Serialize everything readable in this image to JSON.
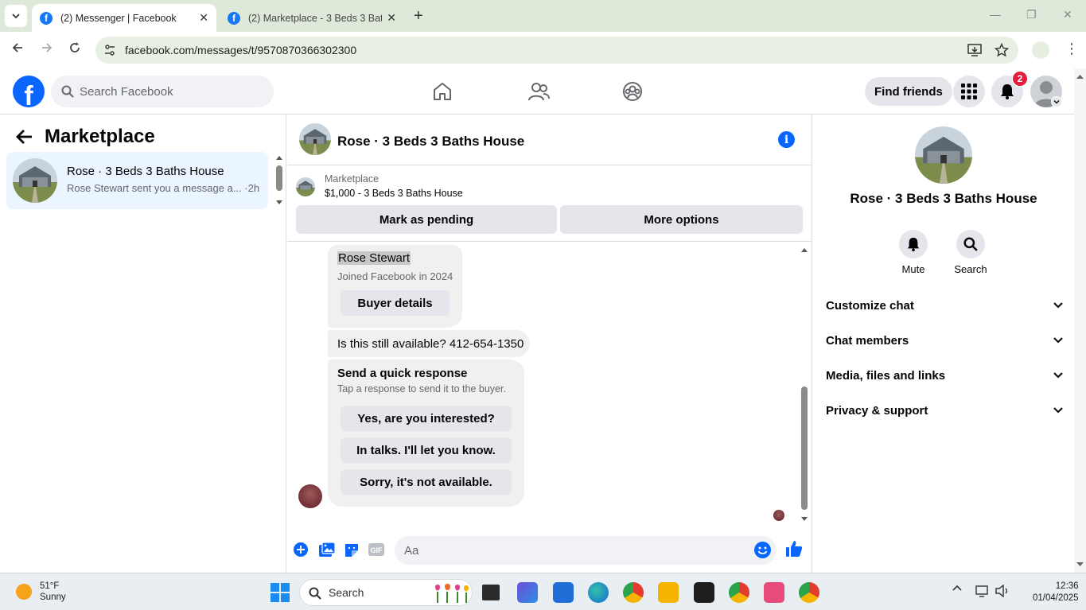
{
  "browser": {
    "tabs": [
      {
        "title": "(2) Messenger | Facebook",
        "active": true
      },
      {
        "title": "(2) Marketplace - 3 Beds 3 Bath",
        "active": false
      }
    ],
    "url": "facebook.com/messages/t/9570870366302300",
    "new_tab_icon": "plus-icon"
  },
  "header": {
    "logo": "f",
    "search_placeholder": "Search Facebook",
    "find_friends": "Find friends",
    "notification_count": "2"
  },
  "left_panel": {
    "title": "Marketplace",
    "conversations": [
      {
        "title": "Rose · 3 Beds 3 Baths House",
        "snippet": "Rose Stewart sent you a message a... ·2h"
      }
    ]
  },
  "chat": {
    "title": "Rose · 3 Beds 3 Baths House",
    "listing_label": "Marketplace",
    "listing_price": "$1,000 - 3 Beds 3 Baths House",
    "mark_pending": "Mark as pending",
    "more_options": "More options",
    "buyer_name": "Rose Stewart",
    "buyer_joined": "Joined Facebook in 2024",
    "buyer_details": "Buyer details",
    "message": "Is this still available? 412-654-1350",
    "quick_title": "Send a quick response",
    "quick_sub": "Tap a response to send it to the buyer.",
    "quick_responses": [
      "Yes, are you interested?",
      "In talks. I'll let you know.",
      "Sorry, it's not available."
    ],
    "composer_placeholder": "Aa"
  },
  "right_panel": {
    "title": "Rose · 3 Beds 3 Baths House",
    "mute": "Mute",
    "search": "Search",
    "sections": [
      "Customize chat",
      "Chat members",
      "Media, files and links",
      "Privacy & support"
    ]
  },
  "taskbar": {
    "temp": "51°F",
    "condition": "Sunny",
    "search": "Search",
    "time": "12:36",
    "date": "01/04/2025"
  },
  "colors": {
    "facebook_blue": "#0866ff",
    "badge_red": "#e41e3f",
    "selected_row": "#ebf5ff"
  }
}
